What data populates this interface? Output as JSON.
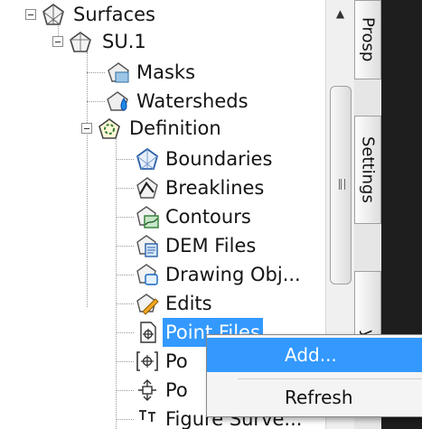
{
  "tree": {
    "items": [
      {
        "label": "Surfaces",
        "icon": "surfaces-icon"
      },
      {
        "label": "SU.1",
        "icon": "surface-icon"
      },
      {
        "label": "Masks",
        "icon": "masks-icon"
      },
      {
        "label": "Watersheds",
        "icon": "watersheds-icon"
      },
      {
        "label": "Definition",
        "icon": "definition-icon"
      },
      {
        "label": "Boundaries",
        "icon": "boundaries-icon"
      },
      {
        "label": "Breaklines",
        "icon": "breaklines-icon"
      },
      {
        "label": "Contours",
        "icon": "contours-icon"
      },
      {
        "label": "DEM Files",
        "icon": "dem-files-icon"
      },
      {
        "label": "Drawing Obj...",
        "icon": "drawing-objects-icon"
      },
      {
        "label": "Edits",
        "icon": "edits-icon"
      },
      {
        "label": "Point Files",
        "icon": "point-files-icon",
        "selected": true
      },
      {
        "label": "Po",
        "icon": "point-groups-icon"
      },
      {
        "label": "Po",
        "icon": "point-survey-queries-icon"
      },
      {
        "label": "Figure Surve...",
        "icon": "figure-survey-icon"
      }
    ]
  },
  "tabs": [
    {
      "label": "Prosp"
    },
    {
      "label": "Settings"
    },
    {
      "label": "y"
    }
  ],
  "context_menu": {
    "items": [
      {
        "label": "Add...",
        "highlighted": true
      },
      {
        "label": "Refresh"
      }
    ]
  },
  "colors": {
    "selection": "#3399ff",
    "background": "#ffffff",
    "dark_panel": "#1e1e1e"
  }
}
